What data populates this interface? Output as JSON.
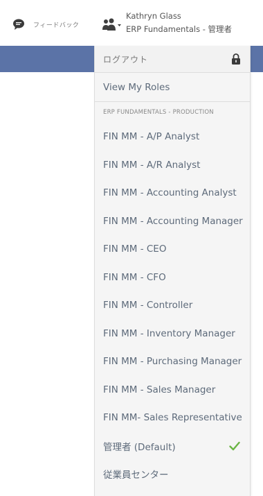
{
  "header": {
    "feedback_label": "フィードバック",
    "user_name": "Kathryn Glass",
    "user_role": "ERP Fundamentals - 管理者"
  },
  "menu": {
    "logout_label": "ログアウト",
    "view_roles_label": "View My Roles",
    "section_title": "ERP FUNDAMENTALS - PRODUCTION",
    "roles": [
      {
        "label": "FIN MM - A/P Analyst"
      },
      {
        "label": "FIN MM - A/R Analyst"
      },
      {
        "label": "FIN MM - Accounting Analyst"
      },
      {
        "label": "FIN MM - Accounting Manager"
      },
      {
        "label": "FIN MM - CEO"
      },
      {
        "label": "FIN MM - CFO"
      },
      {
        "label": "FIN MM - Controller"
      },
      {
        "label": "FIN MM - Inventory Manager"
      },
      {
        "label": "FIN MM - Purchasing Manager"
      },
      {
        "label": "FIN MM - Sales Manager"
      },
      {
        "label": "FIN MM- Sales Representative"
      },
      {
        "label": "管理者 (Default)"
      },
      {
        "label": "従業員センター"
      }
    ]
  },
  "colors": {
    "header_band": "#5b73a7",
    "menu_background": "#f5f5f5",
    "check_green": "#6bb544"
  },
  "icons": {
    "feedback": "speech-bubble",
    "user": "users",
    "logout": "lock",
    "selected": "checkmark"
  }
}
